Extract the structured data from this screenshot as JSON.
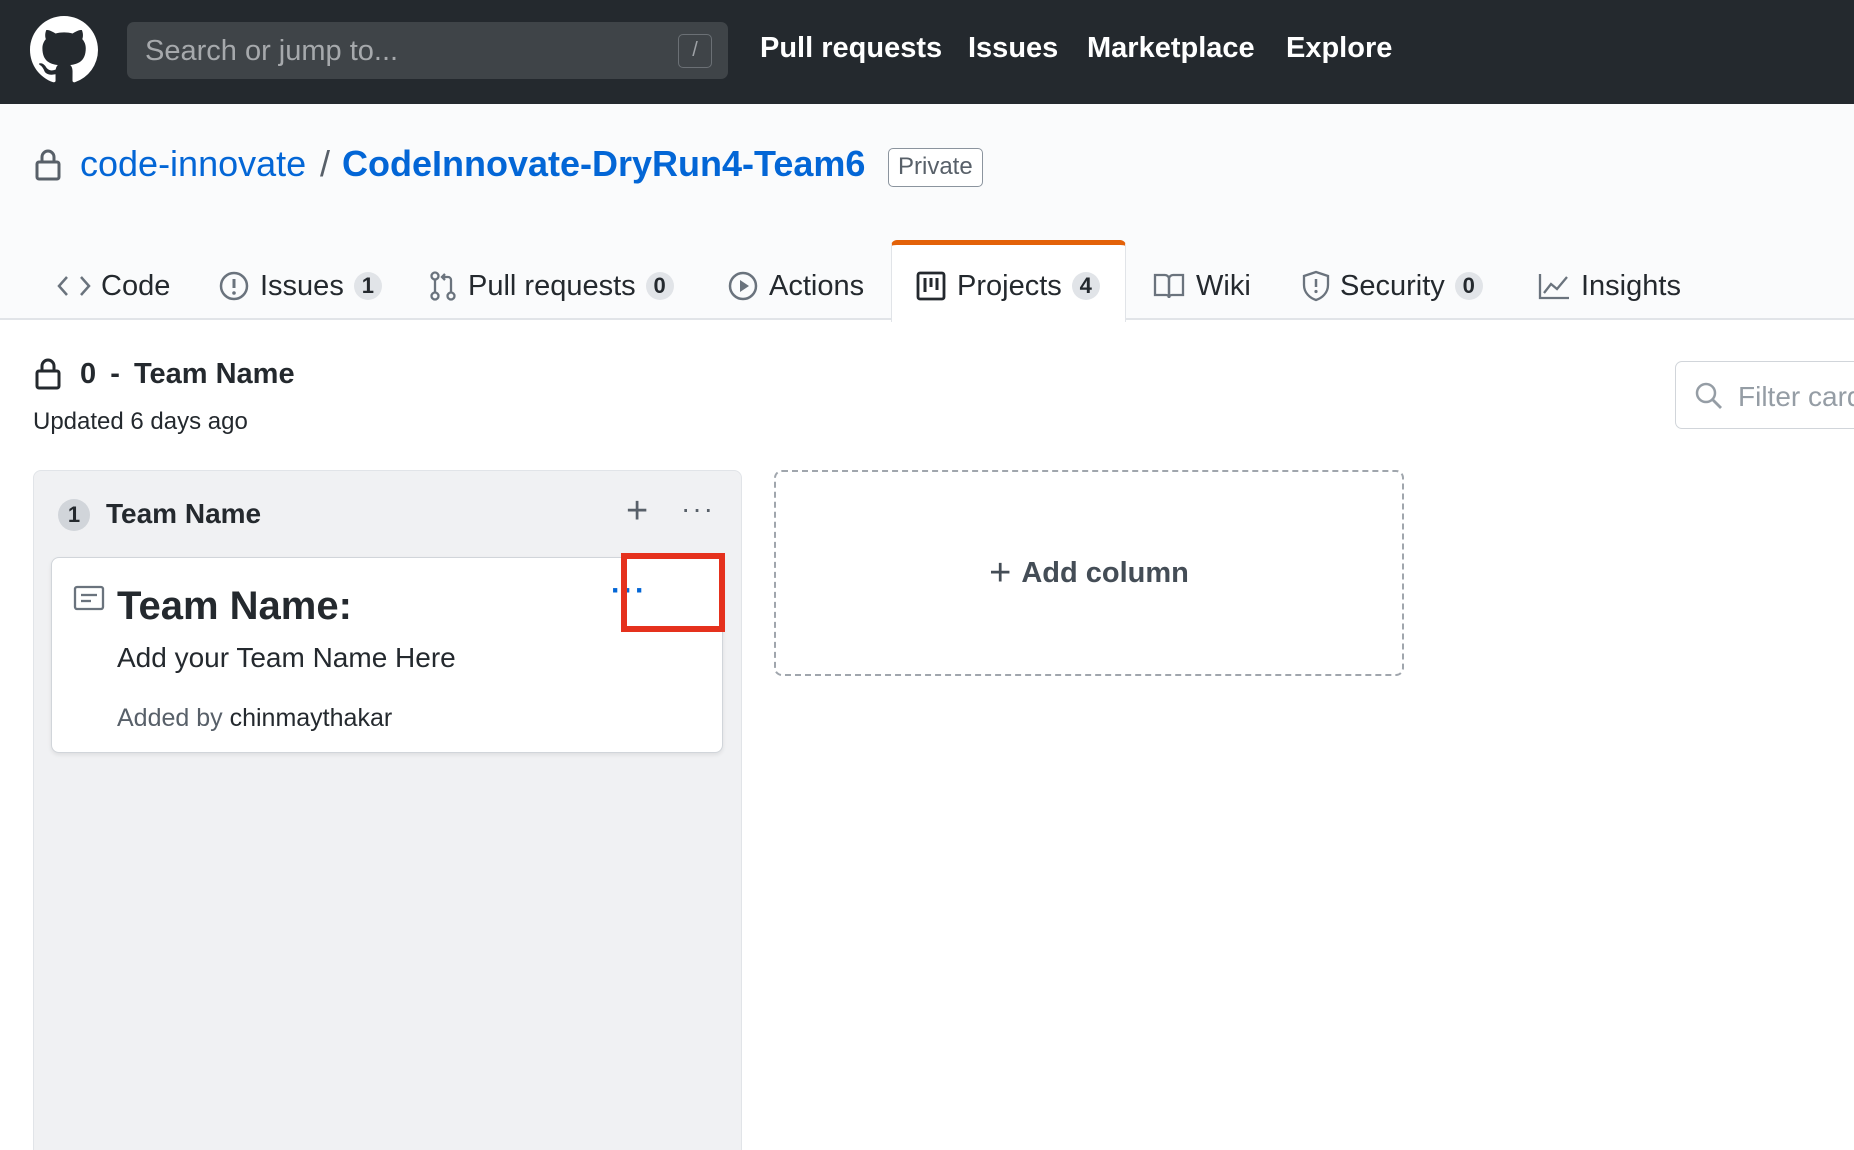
{
  "header": {
    "search_placeholder": "Search or jump to...",
    "slash_key": "/",
    "nav": [
      "Pull requests",
      "Issues",
      "Marketplace",
      "Explore"
    ]
  },
  "repo": {
    "owner": "code-innovate",
    "separator": "/",
    "name": "CodeInnovate-DryRun4-Team6",
    "visibility": "Private"
  },
  "tabs": [
    {
      "label": "Code",
      "count": null,
      "icon": "code-icon"
    },
    {
      "label": "Issues",
      "count": "1",
      "icon": "issue-icon"
    },
    {
      "label": "Pull requests",
      "count": "0",
      "icon": "pull-request-icon"
    },
    {
      "label": "Actions",
      "count": null,
      "icon": "play-icon"
    },
    {
      "label": "Projects",
      "count": "4",
      "icon": "project-icon",
      "active": true
    },
    {
      "label": "Wiki",
      "count": null,
      "icon": "book-icon"
    },
    {
      "label": "Security",
      "count": "0",
      "icon": "shield-icon"
    },
    {
      "label": "Insights",
      "count": null,
      "icon": "graph-icon"
    }
  ],
  "project": {
    "number": "0",
    "dash": "-",
    "title": "Team Name",
    "updated": "Updated 6 days ago",
    "filter_placeholder": "Filter cards"
  },
  "column": {
    "count": "1",
    "title": "Team Name",
    "card": {
      "title": "Team Name:",
      "body": "Add your Team Name Here",
      "added_by_label": "Added by",
      "added_by_user": "chinmaythakar"
    }
  },
  "add_column_label": "Add column",
  "colors": {
    "header_bg": "#24292e",
    "link": "#0366d6",
    "active_tab": "#e36209",
    "highlight": "#e5311d"
  }
}
